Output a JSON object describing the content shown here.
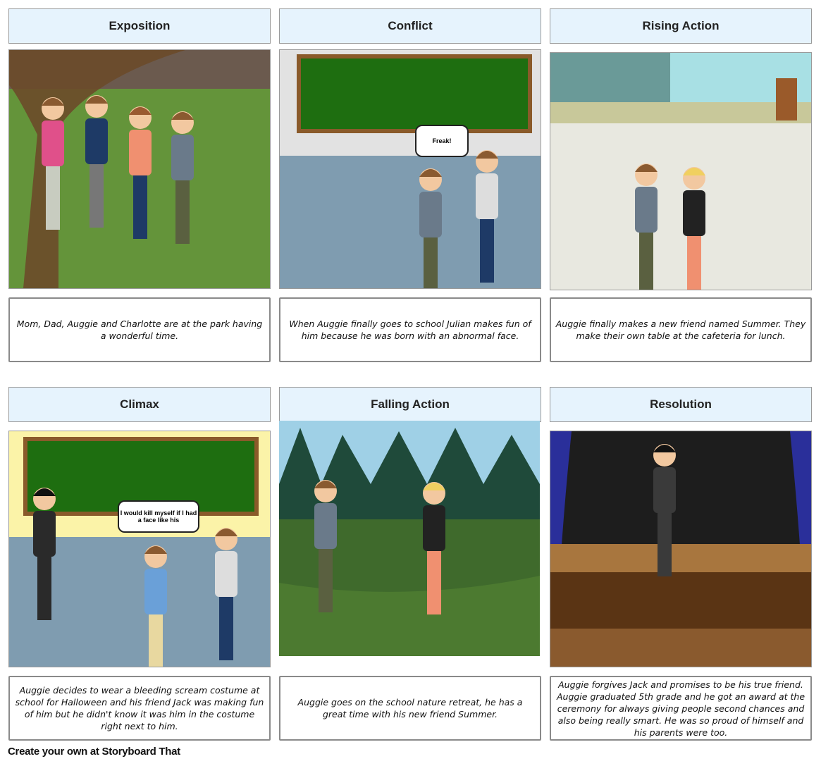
{
  "panels": [
    {
      "title": "Exposition",
      "caption": "Mom, Dad, Auggie and Charlotte are at the park having a wonderful time."
    },
    {
      "title": "Conflict",
      "caption": "When Auggie finally goes to school Julian makes fun of him because he was born with an abnormal face.",
      "speech": "Freak!"
    },
    {
      "title": "Rising Action",
      "caption": "Auggie finally makes a new friend named Summer. They make their own table at the cafeteria for lunch."
    },
    {
      "title": "Climax",
      "caption": "Auggie decides to wear a bleeding scream costume at school for Halloween and his friend Jack was making fun of him but he didn't know it was him in the costume right next to him.",
      "speech": "I would kill myself if I had a face like his"
    },
    {
      "title": "Falling Action",
      "caption": "Auggie goes on the school nature retreat, he has a great time with his new friend Summer."
    },
    {
      "title": "Resolution",
      "caption": "Auggie forgives Jack and promises to be his true friend. Auggie graduated 5th grade and he got an award at the ceremony for always giving people second chances and also being really smart. He was so proud of himself and his parents were too."
    }
  ],
  "footer": "Create your own at Storyboard That",
  "colors": {
    "header_bg": "#e6f3fd",
    "chalkboard": "#1e6e10",
    "grass": "#5f8f34"
  }
}
